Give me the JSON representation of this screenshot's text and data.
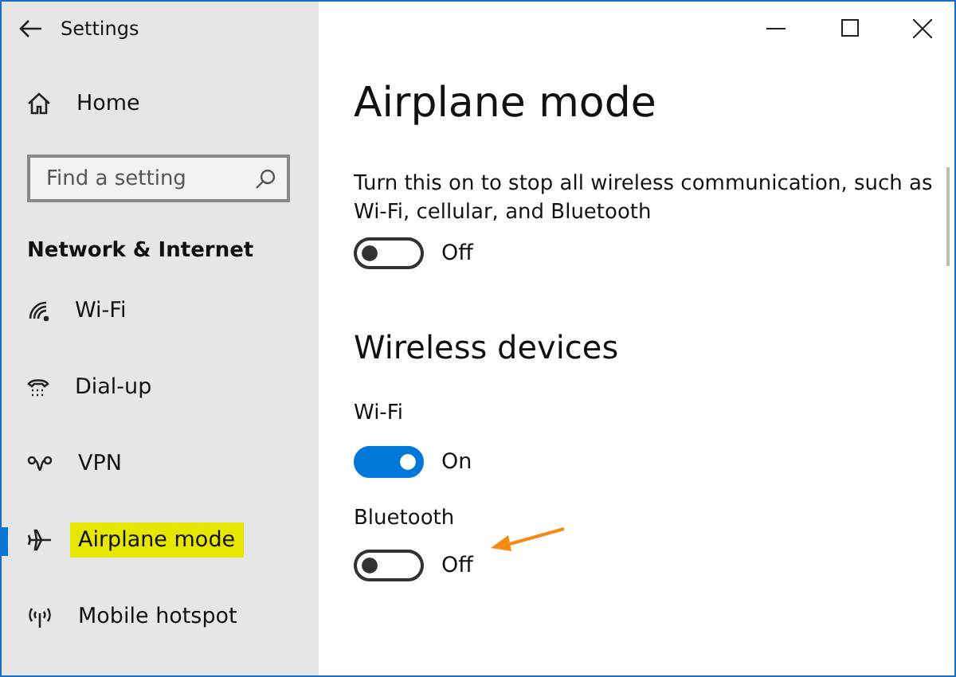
{
  "window": {
    "title": "Settings"
  },
  "sidebar": {
    "home": "Home",
    "search": {
      "placeholder": "Find a setting"
    },
    "section": "Network & Internet",
    "items": [
      {
        "kind": "wifi",
        "label": "Wi-Fi",
        "selected": false,
        "highlighted": false
      },
      {
        "kind": "dialup",
        "label": "Dial-up",
        "selected": false,
        "highlighted": false
      },
      {
        "kind": "vpn",
        "label": "VPN",
        "selected": false,
        "highlighted": false
      },
      {
        "kind": "airplane",
        "label": "Airplane mode",
        "selected": true,
        "highlighted": true
      },
      {
        "kind": "hotspot",
        "label": "Mobile hotspot",
        "selected": false,
        "highlighted": false
      }
    ]
  },
  "page": {
    "title": "Airplane mode",
    "airplane": {
      "description": "Turn this on to stop all wireless communication, such as Wi-Fi, cellular, and Bluetooth",
      "on": false,
      "state_label": "Off"
    },
    "section": "Wireless devices",
    "devices": [
      {
        "name": "Wi-Fi",
        "on": true,
        "state_label": "On",
        "pointer_arrow": false
      },
      {
        "name": "Bluetooth",
        "on": false,
        "state_label": "Off",
        "pointer_arrow": true
      }
    ]
  }
}
